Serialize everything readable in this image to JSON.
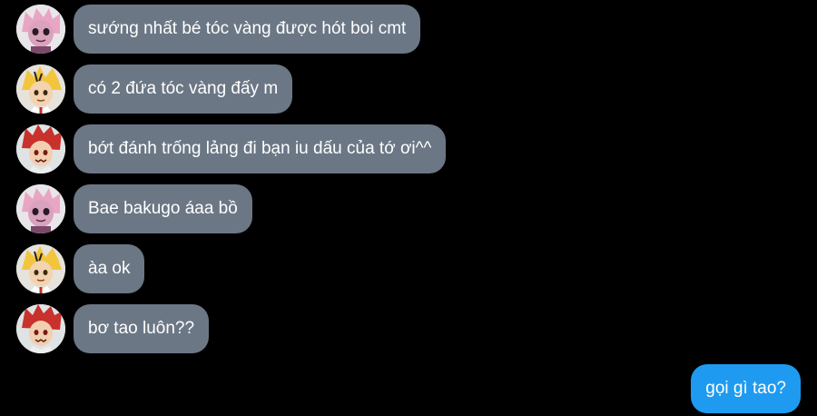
{
  "messages": [
    {
      "sender": "pink-hair-avatar",
      "text": "sướng nhất bé tóc vàng được hót boi cmt"
    },
    {
      "sender": "yellow-hair-avatar",
      "text": "có 2 đứa tóc vàng đấy m"
    },
    {
      "sender": "red-hair-avatar",
      "text": "bớt đánh trống lảng đi bạn iu dấu của tớ ơi^^"
    },
    {
      "sender": "pink-hair-avatar",
      "text": "Bae bakugo áaa bồ"
    },
    {
      "sender": "yellow-hair-avatar",
      "text": "àa ok"
    },
    {
      "sender": "red-hair-avatar",
      "text": "bơ tao luôn??"
    }
  ],
  "my_message": {
    "text": "gọi gì tao?"
  },
  "colors": {
    "background": "#000000",
    "incoming_bubble": "#6b7785",
    "outgoing_bubble": "#1e9bf0",
    "text": "#ffffff"
  }
}
